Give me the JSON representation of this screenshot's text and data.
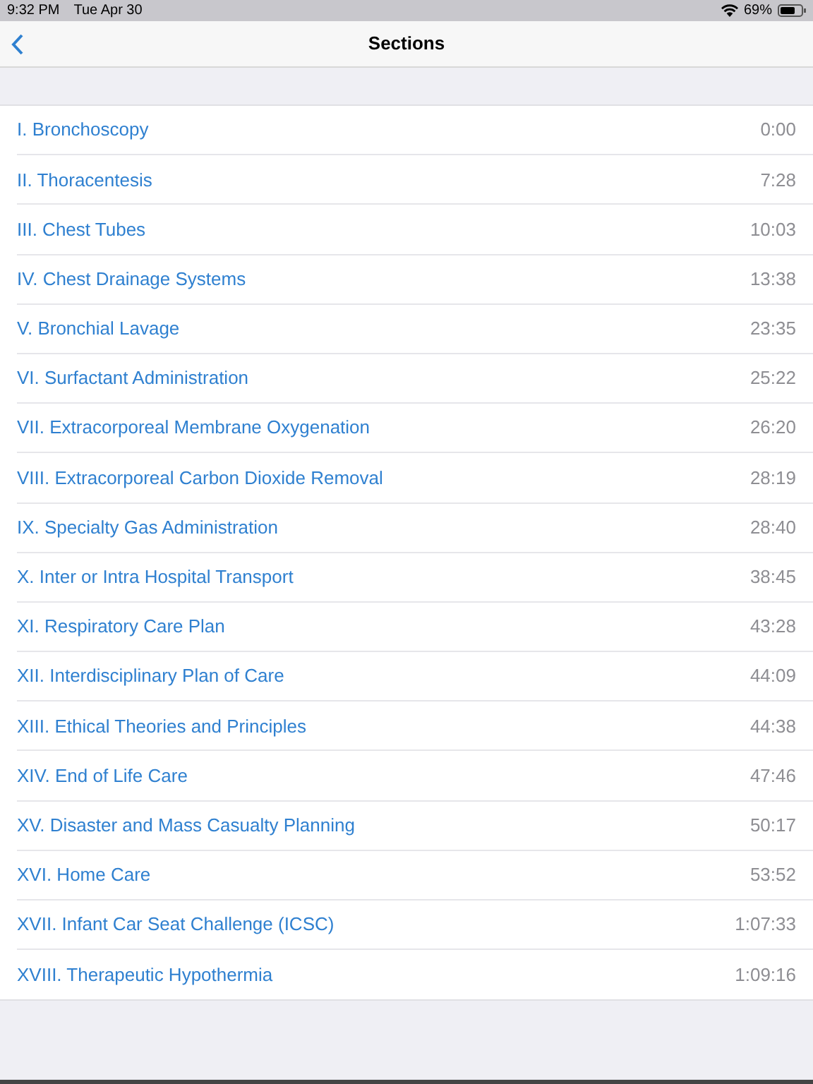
{
  "status_bar": {
    "time": "9:32 PM",
    "date": "Tue Apr 30",
    "battery": "69%"
  },
  "nav": {
    "title": "Sections"
  },
  "sections": [
    {
      "title": "I. Bronchoscopy",
      "time": "0:00"
    },
    {
      "title": "II. Thoracentesis",
      "time": "7:28"
    },
    {
      "title": "III. Chest Tubes",
      "time": "10:03"
    },
    {
      "title": "IV. Chest Drainage Systems",
      "time": "13:38"
    },
    {
      "title": "V. Bronchial Lavage",
      "time": "23:35"
    },
    {
      "title": "VI. Surfactant Administration",
      "time": "25:22"
    },
    {
      "title": "VII. Extracorporeal Membrane Oxygenation",
      "time": "26:20"
    },
    {
      "title": "VIII. Extracorporeal Carbon Dioxide Removal",
      "time": "28:19"
    },
    {
      "title": "IX. Specialty Gas Administration",
      "time": "28:40"
    },
    {
      "title": "X. Inter or Intra Hospital Transport",
      "time": "38:45"
    },
    {
      "title": "XI. Respiratory Care Plan",
      "time": "43:28"
    },
    {
      "title": "XII. Interdisciplinary Plan of Care",
      "time": "44:09"
    },
    {
      "title": "XIII. Ethical Theories and Principles",
      "time": "44:38"
    },
    {
      "title": "XIV. End of Life Care",
      "time": "47:46"
    },
    {
      "title": "XV. Disaster and Mass Casualty Planning",
      "time": "50:17"
    },
    {
      "title": "XVI. Home Care",
      "time": "53:52"
    },
    {
      "title": "XVII. Infant Car Seat Challenge (ICSC)",
      "time": "1:07:33"
    },
    {
      "title": "XVIII. Therapeutic Hypothermia",
      "time": "1:09:16"
    }
  ]
}
